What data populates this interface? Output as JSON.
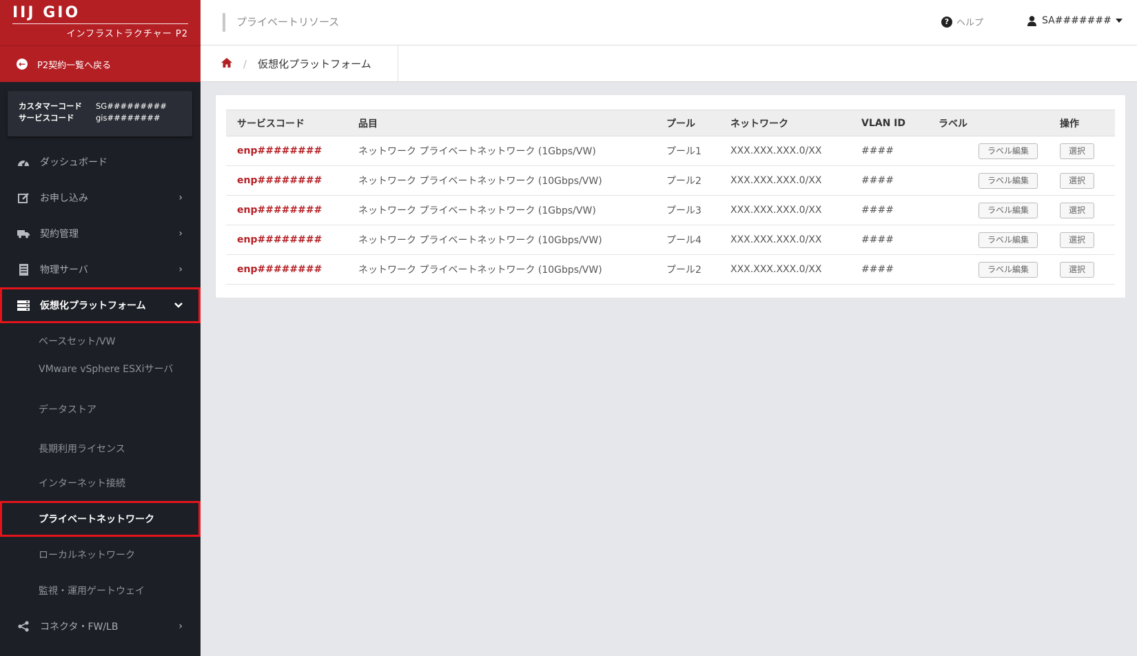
{
  "brand": {
    "logo": "IIJ GIO",
    "subtitle": "インフラストラクチャー P2"
  },
  "back_label": "P2契約一覧へ戻る",
  "codes": {
    "customer_label": "カスタマーコード",
    "customer_value": "SG#########",
    "service_label": "サービスコード",
    "service_value": "gis########"
  },
  "nav": {
    "dashboard": "ダッシュボード",
    "apply": "お申し込み",
    "contract": "契約管理",
    "physical": "物理サーバ",
    "virtual": "仮想化プラットフォーム",
    "sub": {
      "baseset": "ベースセット/VW",
      "esxi": "VMware vSphere ESXiサーバ",
      "datastore": "データストア",
      "license": "長期利用ライセンス",
      "internet": "インターネット接続",
      "private": "プライベートネットワーク",
      "local": "ローカルネットワーク",
      "gateway": "監視・運用ゲートウェイ"
    },
    "connector": "コネクタ・FW/LB"
  },
  "topbar": {
    "title": "プライベートリソース",
    "help": "ヘルプ",
    "user": "SA#######"
  },
  "breadcrumb": {
    "current": "仮想化プラットフォーム"
  },
  "table": {
    "headers": {
      "code": "サービスコード",
      "item": "品目",
      "pool": "プール",
      "network": "ネットワーク",
      "vlan": "VLAN ID",
      "label": "ラベル",
      "ops": "操作"
    },
    "label_button": "ラベル編集",
    "select_button": "選択",
    "rows": [
      {
        "code": "enp########",
        "item": "ネットワーク プライベートネットワーク (1Gbps/VW)",
        "pool": "プール1",
        "network": "XXX.XXX.XXX.0/XX",
        "vlan": "####"
      },
      {
        "code": "enp########",
        "item": "ネットワーク プライベートネットワーク (10Gbps/VW)",
        "pool": "プール2",
        "network": "XXX.XXX.XXX.0/XX",
        "vlan": "####"
      },
      {
        "code": "enp########",
        "item": "ネットワーク プライベートネットワーク (1Gbps/VW)",
        "pool": "プール3",
        "network": "XXX.XXX.XXX.0/XX",
        "vlan": "####"
      },
      {
        "code": "enp########",
        "item": "ネットワーク プライベートネットワーク (10Gbps/VW)",
        "pool": "プール4",
        "network": "XXX.XXX.XXX.0/XX",
        "vlan": "####"
      },
      {
        "code": "enp########",
        "item": "ネットワーク プライベートネットワーク (10Gbps/VW)",
        "pool": "プール2",
        "network": "XXX.XXX.XXX.0/XX",
        "vlan": "####"
      }
    ]
  },
  "colors": {
    "brand_red": "#b41f24",
    "sidebar": "#1c1f26",
    "highlight": "#e4141b"
  },
  "icons": [
    "back-arrow-icon",
    "dashboard-icon",
    "edit-icon",
    "truck-icon",
    "server-icon",
    "stack-icon",
    "share-icon",
    "chevron-right-icon",
    "chevron-down-icon",
    "help-icon",
    "user-icon",
    "caret-down-icon",
    "home-icon"
  ]
}
